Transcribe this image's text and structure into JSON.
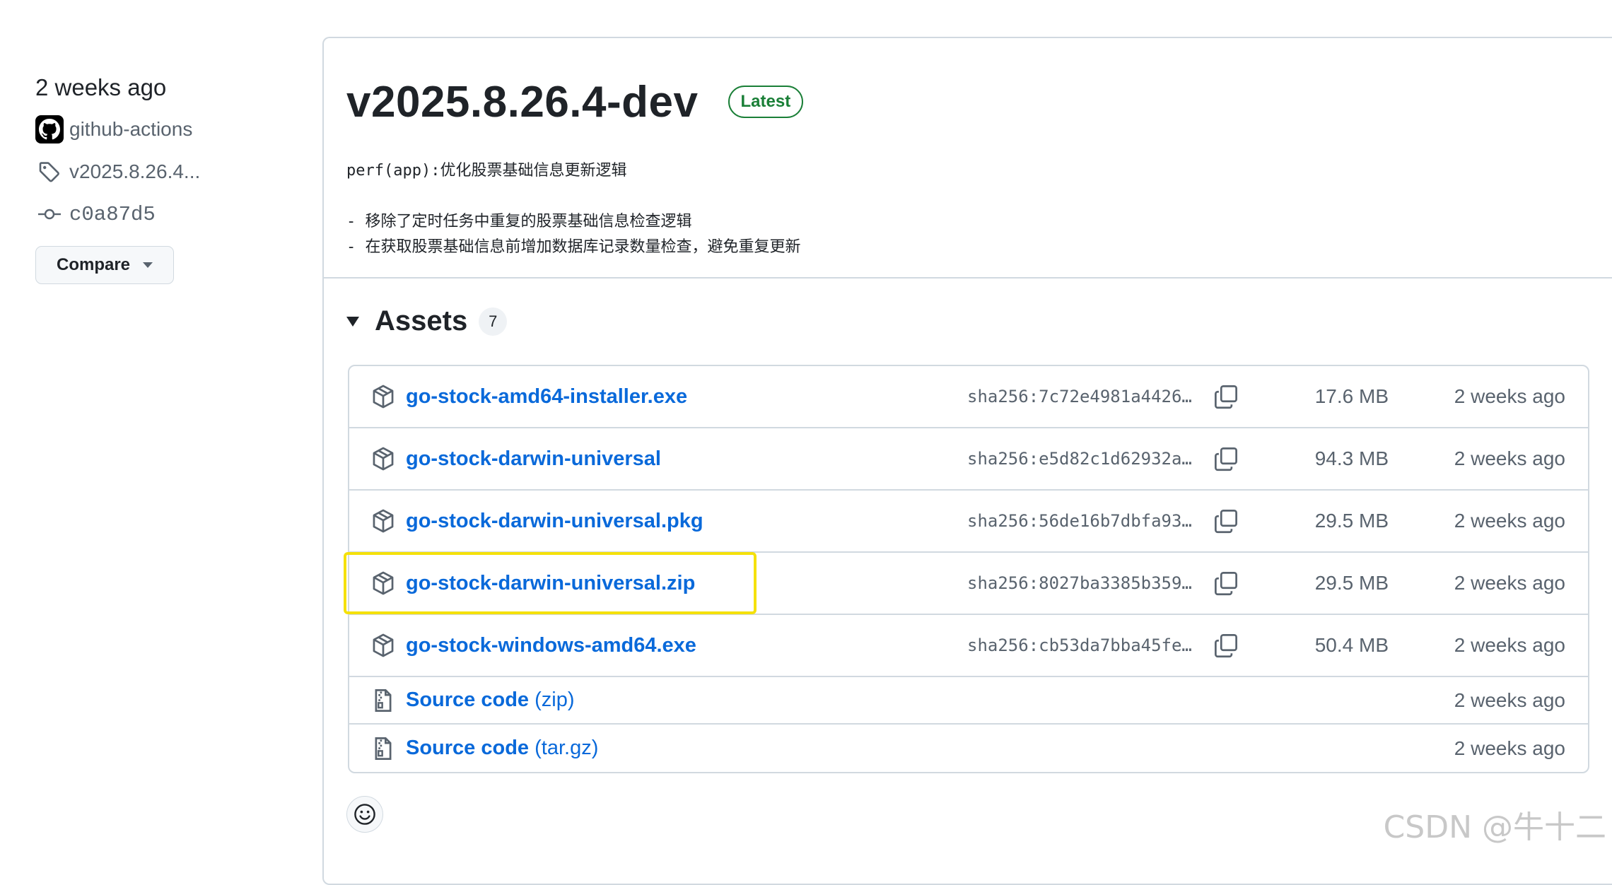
{
  "sidebar": {
    "time": "2 weeks ago",
    "author": "github-actions",
    "tag": "v2025.8.26.4...",
    "commit": "c0a87d5",
    "compare_label": "Compare"
  },
  "release": {
    "title": "v2025.8.26.4-dev",
    "badge": "Latest",
    "notes_line1": "perf(app):优化股票基础信息更新逻辑",
    "notes_line2": "- 移除了定时任务中重复的股票基础信息检查逻辑",
    "notes_line3": "- 在获取股票基础信息前增加数据库记录数量检查，避免重复更新"
  },
  "assets": {
    "title": "Assets",
    "count": "7",
    "rows": [
      {
        "name": "go-stock-amd64-installer.exe",
        "sha": "sha256:7c72e4981a4426…",
        "size": "17.6 MB",
        "date": "2 weeks ago"
      },
      {
        "name": "go-stock-darwin-universal",
        "sha": "sha256:e5d82c1d62932a…",
        "size": "94.3 MB",
        "date": "2 weeks ago"
      },
      {
        "name": "go-stock-darwin-universal.pkg",
        "sha": "sha256:56de16b7dbfa93…",
        "size": "29.5 MB",
        "date": "2 weeks ago"
      },
      {
        "name": "go-stock-darwin-universal.zip",
        "sha": "sha256:8027ba3385b359…",
        "size": "29.5 MB",
        "date": "2 weeks ago"
      },
      {
        "name": "go-stock-windows-amd64.exe",
        "sha": "sha256:cb53da7bba45fe…",
        "size": "50.4 MB",
        "date": "2 weeks ago"
      }
    ],
    "source": [
      {
        "name": "Source code",
        "sub": "(zip)",
        "date": "2 weeks ago"
      },
      {
        "name": "Source code",
        "sub": "(tar.gz)",
        "date": "2 weeks ago"
      }
    ]
  },
  "watermark": "CSDN @牛十二",
  "colors": {
    "link": "#0969da",
    "latest": "#1a7f37",
    "highlight": "#f5e10a"
  }
}
